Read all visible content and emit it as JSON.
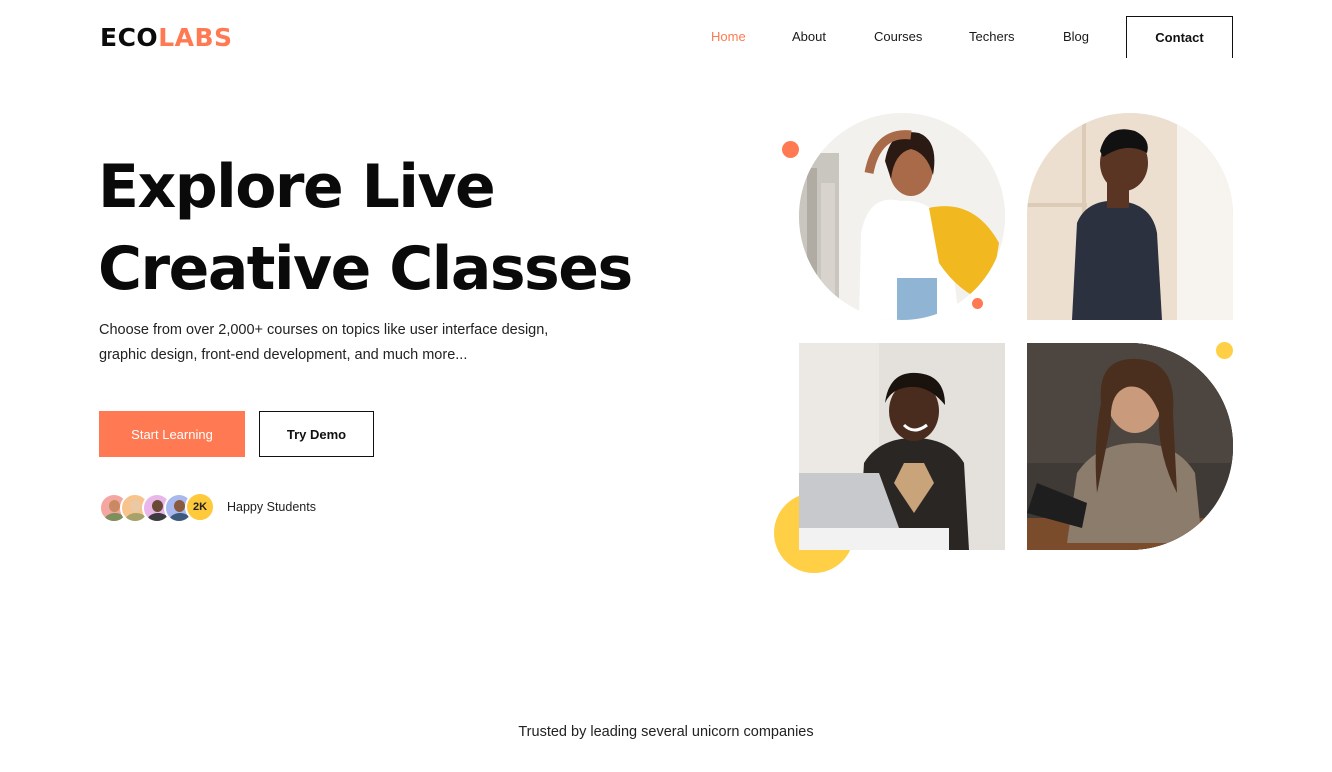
{
  "brand": {
    "part1": "ECO",
    "part2": "LABS",
    "accent_color": "#ff7a52"
  },
  "nav": {
    "items": [
      "Home",
      "About",
      "Courses",
      "Techers",
      "Blog"
    ],
    "active": "Home",
    "contact_label": "Contact"
  },
  "hero": {
    "title_line1": "Explore Live",
    "title_line2": "Creative Classes",
    "subtitle_line1": "Choose from over 2,000+ courses on topics like user interface design,",
    "subtitle_line2": "graphic design, front-end development, and much more...",
    "primary_button": "Start Learning",
    "secondary_button": "Try Demo",
    "students_count": "2K",
    "students_label": "Happy Students"
  },
  "images": [
    {
      "name": "student-photo-woman-backpack"
    },
    {
      "name": "student-photo-man-standing"
    },
    {
      "name": "student-photo-man-laptop"
    },
    {
      "name": "student-photo-woman-notebook"
    }
  ],
  "colors": {
    "accent": "#ff7a52",
    "yellow": "#ffcf45"
  },
  "footer": {
    "trusted_text": "Trusted by leading several unicorn companies"
  }
}
